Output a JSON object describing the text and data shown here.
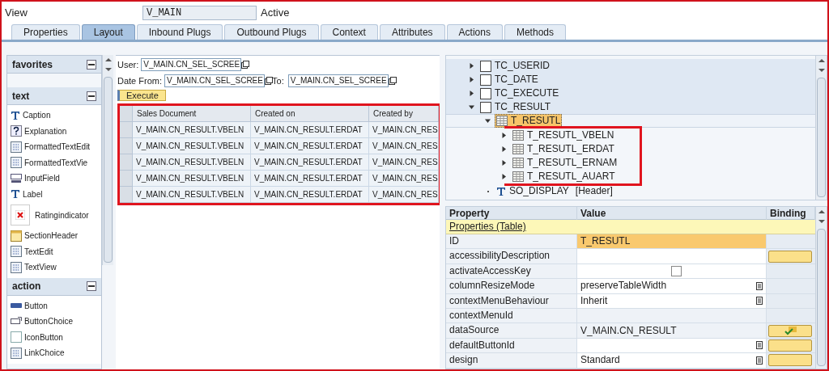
{
  "view": {
    "label": "View",
    "name": "V_MAIN",
    "status": "Active"
  },
  "tabs": [
    {
      "label": "Properties",
      "selected": false
    },
    {
      "label": "Layout",
      "selected": true
    },
    {
      "label": "Inbound Plugs",
      "selected": false
    },
    {
      "label": "Outbound Plugs",
      "selected": false
    },
    {
      "label": "Context",
      "selected": false
    },
    {
      "label": "Attributes",
      "selected": false
    },
    {
      "label": "Actions",
      "selected": false
    },
    {
      "label": "Methods",
      "selected": false
    }
  ],
  "palette": [
    {
      "title": "favorites"
    },
    {
      "title": "text",
      "items": [
        {
          "label": "Caption",
          "kind": "plain"
        },
        {
          "label": "Explanation",
          "kind": "plain"
        },
        {
          "label": "FormattedTextEdit",
          "kind": "plain"
        },
        {
          "label": "FormattedTextVie",
          "kind": "plain"
        },
        {
          "label": "InputField",
          "kind": "plain"
        },
        {
          "label": "Label",
          "kind": "plain"
        },
        {
          "label": "Ratingindicator",
          "kind": "preview"
        },
        {
          "label": "SectionHeader",
          "kind": "plain"
        },
        {
          "label": "TextEdit",
          "kind": "plain"
        },
        {
          "label": "TextView",
          "kind": "plain"
        }
      ]
    },
    {
      "title": "action",
      "items": [
        {
          "label": "Button",
          "kind": "plain"
        },
        {
          "label": "ButtonChoice",
          "kind": "plain"
        },
        {
          "label": "IconButton",
          "kind": "plain"
        },
        {
          "label": "LinkChoice",
          "kind": "plain"
        }
      ]
    }
  ],
  "form": {
    "user_label": "User:",
    "user_value": "V_MAIN.CN_SEL_SCREE",
    "from_label": "Date From:",
    "from_value": "V_MAIN.CN_SEL_SCREE",
    "to_label": "To:",
    "to_value": "V_MAIN.CN_SEL_SCREE",
    "execute": "Execute"
  },
  "table": {
    "outlined": true,
    "columns": [
      "Sales Document",
      "Created on",
      "Created by"
    ],
    "rows": [
      [
        "V_MAIN.CN_RESULT.VBELN",
        "V_MAIN.CN_RESULT.ERDAT",
        "V_MAIN.CN_RES"
      ],
      [
        "V_MAIN.CN_RESULT.VBELN",
        "V_MAIN.CN_RESULT.ERDAT",
        "V_MAIN.CN_RES"
      ],
      [
        "V_MAIN.CN_RESULT.VBELN",
        "V_MAIN.CN_RESULT.ERDAT",
        "V_MAIN.CN_RES"
      ],
      [
        "V_MAIN.CN_RESULT.VBELN",
        "V_MAIN.CN_RESULT.ERDAT",
        "V_MAIN.CN_RES"
      ],
      [
        "V_MAIN.CN_RESULT.VBELN",
        "V_MAIN.CN_RESULT.ERDAT",
        "V_MAIN.CN_RES"
      ]
    ]
  },
  "tree": [
    {
      "label": "TC_USERID",
      "kind": "container",
      "expanded": false,
      "selected": false
    },
    {
      "label": "TC_DATE",
      "kind": "container",
      "expanded": false,
      "selected": false
    },
    {
      "label": "TC_EXECUTE",
      "kind": "container",
      "expanded": false,
      "selected": false
    },
    {
      "label": "TC_RESULT",
      "kind": "container",
      "expanded": true,
      "selected": false,
      "children": [
        {
          "label": "T_RESUTL",
          "kind": "table",
          "expanded": true,
          "selected": true,
          "outlined": true,
          "children": [
            {
              "label": "T_RESUTL_VBELN",
              "kind": "table",
              "expanded": false,
              "selected": false
            },
            {
              "label": "T_RESUTL_ERDAT",
              "kind": "table",
              "expanded": false,
              "selected": false
            },
            {
              "label": "T_RESUTL_ERNAM",
              "kind": "table",
              "expanded": false,
              "selected": false
            },
            {
              "label": "T_RESUTL_AUART",
              "kind": "table",
              "expanded": false,
              "selected": false
            }
          ]
        },
        {
          "label": "SO_DISPLAY",
          "suffix": "[Header]",
          "kind": "caption",
          "selected": false
        }
      ]
    }
  ],
  "properties": {
    "columns": [
      "Property",
      "Value",
      "Binding"
    ],
    "section": "Properties (Table)",
    "rows": [
      {
        "name": "ID",
        "value": "T_RESUTL",
        "kind": "highlight",
        "binding_button": false
      },
      {
        "name": "accessibilityDescription",
        "kind": "input",
        "binding_button": true,
        "bound": false
      },
      {
        "name": "activateAccessKey",
        "kind": "checkbox",
        "checked": false,
        "binding_button": false
      },
      {
        "name": "columnResizeMode",
        "value": "preserveTableWidth",
        "kind": "select",
        "binding_button": false
      },
      {
        "name": "contextMenuBehaviour",
        "value": "Inherit",
        "kind": "select",
        "binding_button": false
      },
      {
        "name": "contextMenuId",
        "kind": "readonly",
        "binding_button": false
      },
      {
        "name": "dataSource",
        "value": "V_MAIN.CN_RESULT",
        "kind": "readonly",
        "binding_button": true,
        "bound": true
      },
      {
        "name": "defaultButtonId",
        "kind": "select",
        "binding_button": true,
        "bound": false
      },
      {
        "name": "design",
        "value": "Standard",
        "kind": "select",
        "binding_button": true,
        "bound": false
      }
    ]
  }
}
